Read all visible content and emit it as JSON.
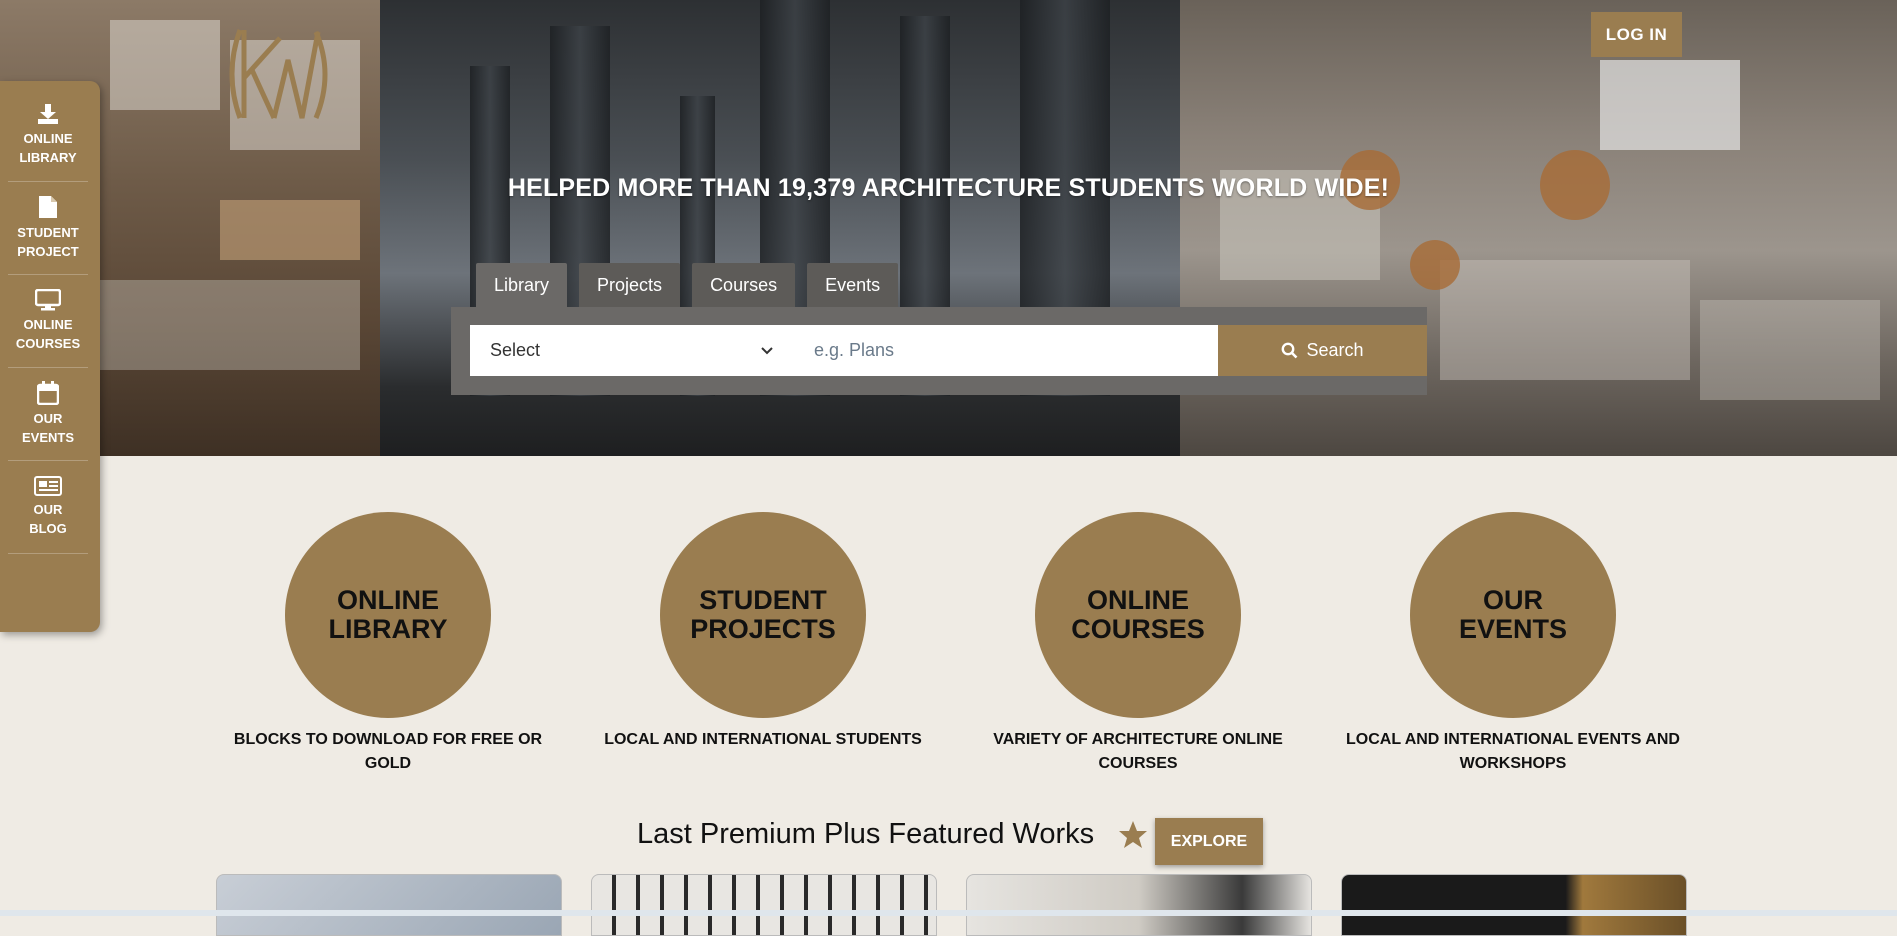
{
  "header": {
    "login_label": "LOG IN",
    "headline": "HELPED MORE THAN 19,379 ARCHITECTURE STUDENTS WORLD WIDE!"
  },
  "search": {
    "tabs": [
      {
        "label": "Library"
      },
      {
        "label": "Projects"
      },
      {
        "label": "Courses"
      },
      {
        "label": "Events"
      }
    ],
    "select_value": "Select",
    "placeholder": "e.g. Plans",
    "button_label": "Search"
  },
  "sidebar": {
    "items": [
      {
        "line1": "ONLINE",
        "line2": "LIBRARY",
        "icon": "download-icon"
      },
      {
        "line1": "STUDENT",
        "line2": "PROJECT",
        "icon": "file-icon"
      },
      {
        "line1": "ONLINE",
        "line2": "COURSES",
        "icon": "monitor-icon"
      },
      {
        "line1": "OUR",
        "line2": "EVENTS",
        "icon": "calendar-icon"
      },
      {
        "line1": "OUR",
        "line2": "BLOG",
        "icon": "newspaper-icon"
      }
    ]
  },
  "features": [
    {
      "title": "ONLINE LIBRARY",
      "desc": "BLOCKS TO DOWNLOAD FOR FREE OR GOLD"
    },
    {
      "title": "STUDENT PROJECTS",
      "desc": "LOCAL AND INTERNATIONAL STUDENTS"
    },
    {
      "title": "ONLINE COURSES",
      "desc": "VARIETY OF ARCHITECTURE ONLINE COURSES"
    },
    {
      "title": "OUR EVENTS",
      "desc": "LOCAL AND INTERNATIONAL EVENTS AND WORKSHOPS"
    }
  ],
  "featured": {
    "title": "Last Premium Plus Featured Works",
    "explore_label": "EXPLORE"
  },
  "colors": {
    "accent": "#9a7d50",
    "background": "#efebe4",
    "search_panel": "#6b6967"
  }
}
